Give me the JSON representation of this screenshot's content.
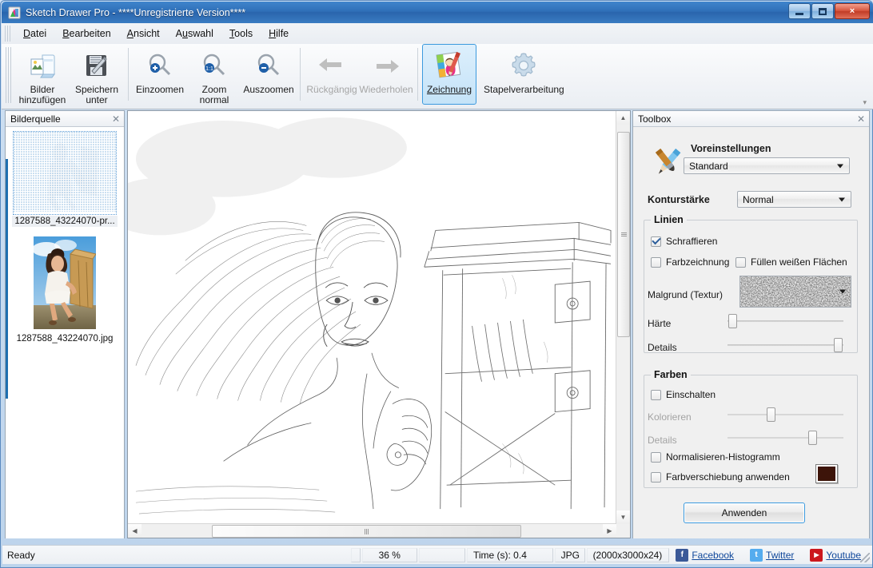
{
  "window": {
    "title": "Sketch Drawer Pro - ****Unregistrierte Version****",
    "minimize_label": "Minimieren",
    "maximize_label": "Maximieren",
    "close_label": "×"
  },
  "menu": {
    "items": [
      {
        "label": "Datei",
        "accel": "D"
      },
      {
        "label": "Bearbeiten",
        "accel": "B"
      },
      {
        "label": "Ansicht",
        "accel": "A"
      },
      {
        "label": "Auswahl",
        "accel": "A"
      },
      {
        "label": "Tools",
        "accel": "T"
      },
      {
        "label": "Hilfe",
        "accel": "H"
      }
    ]
  },
  "toolbar": {
    "buttons": [
      {
        "label_line1": "Bilder",
        "label_line2": "hinzufügen",
        "icon": "add-images-icon",
        "state": "enabled"
      },
      {
        "label_line1": "Speichern",
        "label_line2": "unter",
        "icon": "save-as-icon",
        "state": "enabled"
      },
      {
        "label_line1": "Einzoomen",
        "label_line2": "",
        "icon": "zoom-in-icon",
        "state": "enabled"
      },
      {
        "label_line1": "Zoom",
        "label_line2": "normal",
        "icon": "zoom-normal-icon",
        "state": "enabled"
      },
      {
        "label_line1": "Auszoomen",
        "label_line2": "",
        "icon": "zoom-out-icon",
        "state": "enabled"
      },
      {
        "label_line1": "Rückgängig",
        "label_line2": "",
        "icon": "undo-icon",
        "state": "disabled"
      },
      {
        "label_line1": "Wiederholen",
        "label_line2": "",
        "icon": "redo-icon",
        "state": "disabled"
      },
      {
        "label_line1": "Zeichnung",
        "label_line2": "",
        "icon": "drawing-icon",
        "state": "active"
      },
      {
        "label_line1": "Stapelverarbeitung",
        "label_line2": "",
        "icon": "batch-gear-icon",
        "state": "enabled"
      }
    ],
    "expand_label": "▾"
  },
  "left_dock": {
    "title": "Bilderquelle",
    "close_label": "✕",
    "items": [
      {
        "caption": "1287588_43224070-pr...",
        "selected": true
      },
      {
        "caption": "1287588_43224070.jpg",
        "selected": false
      }
    ]
  },
  "canvas": {
    "vertical_scrollbar": {
      "up": "▲",
      "down": "▼"
    },
    "horizontal_scrollbar": {
      "left": "◀",
      "right": "▶"
    }
  },
  "toolbox": {
    "title": "Toolbox",
    "close_label": "✕",
    "presets_label": "Voreinstellungen",
    "presets_value": "Standard",
    "contour_label": "Konturstärke",
    "contour_value": "Normal",
    "lines_group": {
      "title": "Linien",
      "hatching_label": "Schraffieren",
      "hatching_checked": true,
      "color_drawing_label": "Farbzeichnung",
      "color_drawing_checked": false,
      "fill_white_label": "Füllen weißen Flächen",
      "fill_white_checked": false,
      "texture_label": "Malgrund (Textur)",
      "hardness_label": "Härte",
      "hardness_value": 2,
      "details_label": "Details",
      "details_value": 98
    },
    "colors_group": {
      "title": "Farben",
      "enable_label": "Einschalten",
      "enable_checked": false,
      "colorize_label": "Kolorieren",
      "colorize_value": 38,
      "details_label": "Details",
      "details_value": 76,
      "normalize_label": "Normalisieren-Histogramm",
      "normalize_checked": false,
      "color_shift_label": "Farbverschiebung anwenden",
      "color_shift_checked": false,
      "color_shift_swatch": "#3d1409"
    },
    "apply_label": "Anwenden"
  },
  "statusbar": {
    "ready": "Ready",
    "zoom": "36 %",
    "blank": "",
    "time": "Time (s): 0.4",
    "format": "JPG",
    "dimensions": "(2000x3000x24)",
    "social": [
      {
        "name": "Facebook",
        "glyph": "f",
        "color": "#3b5998"
      },
      {
        "name": "Twitter",
        "glyph": "t",
        "color": "#55acee"
      },
      {
        "name": "Youtube",
        "glyph": "▶",
        "color": "#cc181e"
      }
    ]
  }
}
